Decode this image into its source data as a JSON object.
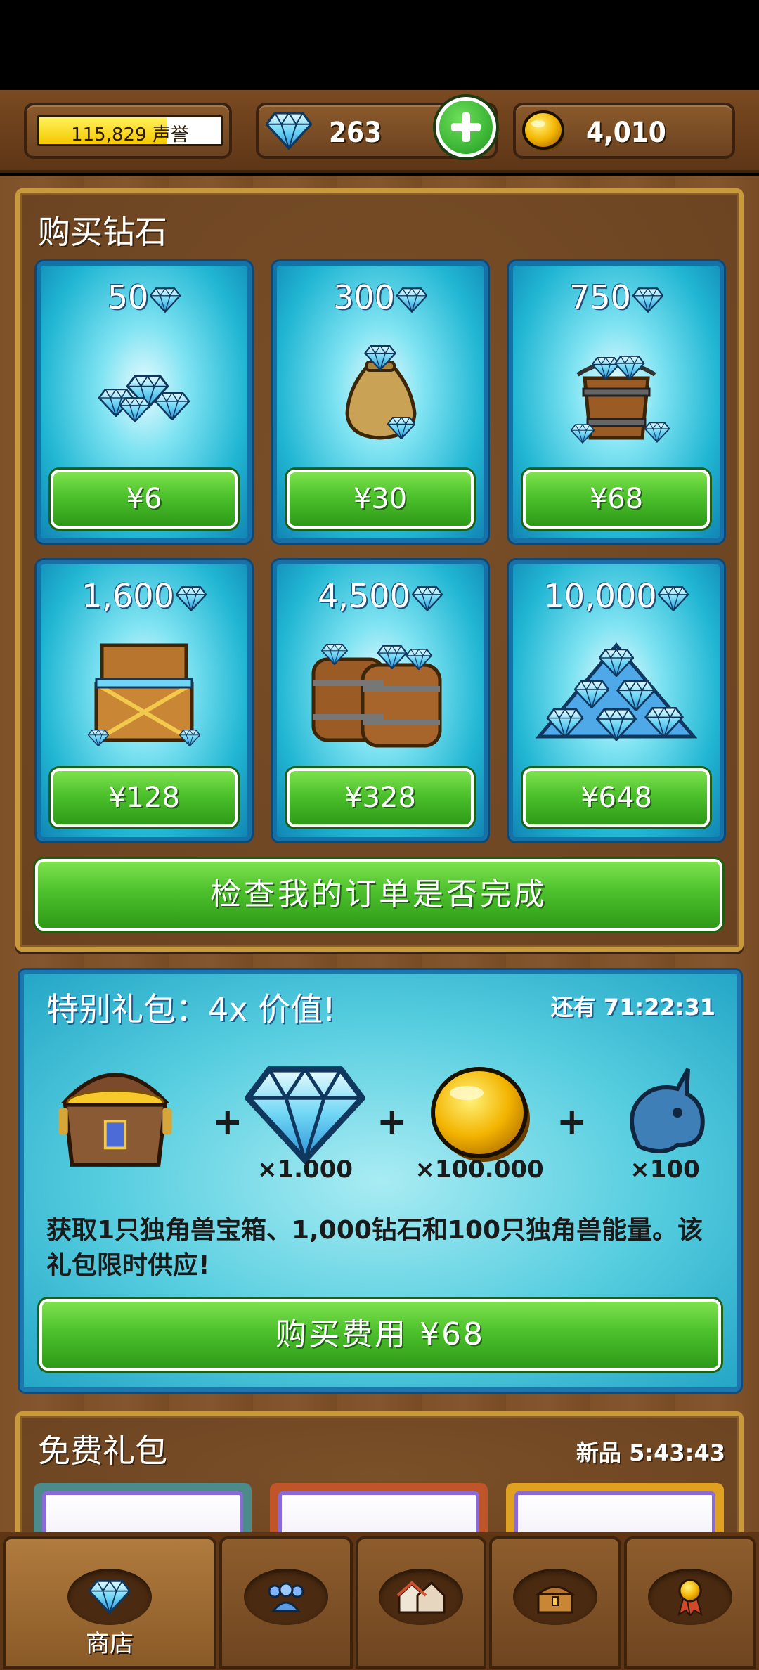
{
  "resources": {
    "reputation_text": "115,829 声誉",
    "reputation_fill": 0.7,
    "diamonds": "263",
    "coins": "4,010"
  },
  "buy_diamonds": {
    "title": "购买钻石",
    "packs": [
      {
        "amount": "50",
        "price": "¥6",
        "icon": "small-diamond-pile-icon"
      },
      {
        "amount": "300",
        "price": "¥30",
        "icon": "diamond-sack-icon"
      },
      {
        "amount": "750",
        "price": "¥68",
        "icon": "diamond-bucket-icon"
      },
      {
        "amount": "1,600",
        "price": "¥128",
        "icon": "diamond-chest-icon"
      },
      {
        "amount": "4,500",
        "price": "¥328",
        "icon": "diamond-barrels-icon"
      },
      {
        "amount": "10,000",
        "price": "¥648",
        "icon": "diamond-mountain-icon"
      }
    ],
    "check_orders_label": "检查我的订单是否完成"
  },
  "special_offer": {
    "title": "特别礼包：4x 价值!",
    "timer": "还有 71:22:31",
    "rewards": [
      {
        "icon": "unicorn-chest-icon",
        "qty": ""
      },
      {
        "icon": "diamond-icon",
        "qty": "×1.000"
      },
      {
        "icon": "coin-icon",
        "qty": "×100.000"
      },
      {
        "icon": "unicorn-icon",
        "qty": "×100"
      }
    ],
    "description": "获取1只独角兽宝箱、1,000钻石和100只独角兽能量。该礼包限时供应!",
    "buy_label": "购买费用 ¥68"
  },
  "free_gifts": {
    "title": "免费礼包",
    "timer": "新品 5:43:43"
  },
  "bottom_nav": {
    "tabs": [
      {
        "label": "商店",
        "icon": "diamond-icon",
        "active": true
      },
      {
        "label": "",
        "icon": "friends-icon",
        "active": false
      },
      {
        "label": "",
        "icon": "houses-icon",
        "active": false
      },
      {
        "label": "",
        "icon": "chest-icon",
        "active": false
      },
      {
        "label": "",
        "icon": "medal-icon",
        "active": false
      }
    ]
  },
  "colors": {
    "wood": "#7e5128",
    "gold_border": "#c99a3a",
    "green_button": "#4cc12c",
    "card_blue": "#21b6d3"
  }
}
